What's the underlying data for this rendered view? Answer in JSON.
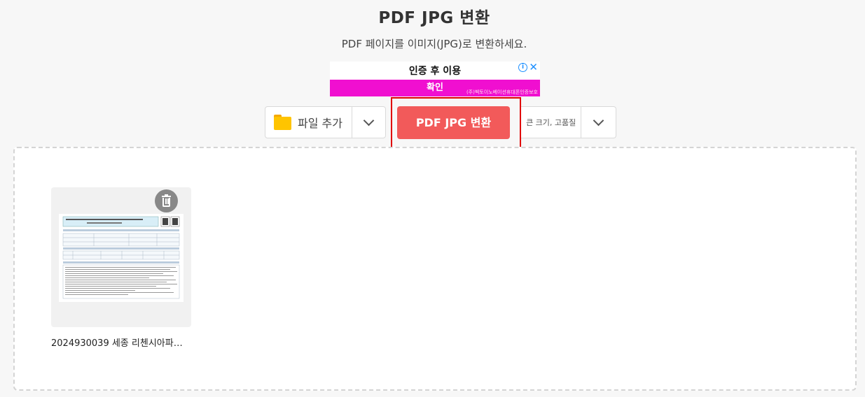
{
  "header": {
    "title": "PDF JPG 변환",
    "subtitle": "PDF 페이지를 이미지(JPG)로 변환하세요."
  },
  "ad": {
    "headline": "인증 후 이용",
    "cta": "확인",
    "sponsor": "(주)벡토이노베이션휴대폰인증보호",
    "info_icon": "info-icon",
    "close_icon": "close-icon",
    "cta_color": "#f00fd0"
  },
  "toolbar": {
    "add_file_label": "파일 추가",
    "convert_label": "PDF JPG 변환",
    "quality_option": "큰 크기, 고품질",
    "convert_color": "#f25a5a",
    "highlight_color": "#e00000"
  },
  "files": [
    {
      "name": "2024930039 세종 리첸시아파…",
      "thumbnail_icon": "pdf-page-thumbnail",
      "delete_icon": "trash-icon"
    }
  ]
}
